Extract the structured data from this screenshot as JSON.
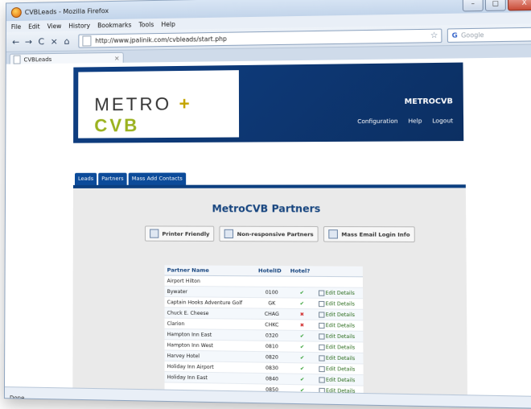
{
  "window": {
    "title": "CVBLeads - Mozilla Firefox",
    "controls": {
      "minimize": "–",
      "maximize": "□",
      "close": "X"
    }
  },
  "menu": [
    "File",
    "Edit",
    "View",
    "History",
    "Bookmarks",
    "Tools",
    "Help"
  ],
  "nav": {
    "back": "←",
    "forward": "→",
    "reload": "C",
    "stop": "×",
    "home": "⌂",
    "url": "http://www.jpalinik.com/cvbleads/start.php",
    "search_placeholder": "Google",
    "search_engine": "G"
  },
  "tabs": [
    {
      "label": "CVBLeads",
      "close": "×"
    }
  ],
  "status": "Done",
  "site": {
    "logo_left": "METRO",
    "logo_plus": "+",
    "logo_right": "CVB",
    "brand": "METROCVB",
    "header_nav": [
      "Configuration",
      "Help",
      "Logout"
    ],
    "page_tabs": [
      "Leads",
      "Partners",
      "Mass Add Contacts"
    ],
    "page_title": "MetroCVB Partners",
    "actions": [
      "Printer Friendly",
      "Non-responsive Partners",
      "Mass Email Login Info"
    ]
  },
  "table": {
    "headers": [
      "Partner Name",
      "HotelID",
      "Hotel?",
      ""
    ],
    "rows": [
      {
        "name": "Airport Hilton",
        "hotel_id": "",
        "hotel": "",
        "edit": ""
      },
      {
        "name": "Bywater",
        "hotel_id": "0100",
        "hotel": "✔",
        "edit": "Edit Details"
      },
      {
        "name": "Captain Hooks Adventure Golf",
        "hotel_id": "GK",
        "hotel": "✔",
        "edit": "Edit Details"
      },
      {
        "name": "Chuck E. Cheese",
        "hotel_id": "CHAG",
        "hotel": "✖",
        "edit": "Edit Details"
      },
      {
        "name": "Clarion",
        "hotel_id": "CHKC",
        "hotel": "✖",
        "edit": "Edit Details"
      },
      {
        "name": "Hampton Inn East",
        "hotel_id": "0320",
        "hotel": "✔",
        "edit": "Edit Details"
      },
      {
        "name": "Hampton Inn West",
        "hotel_id": "0810",
        "hotel": "✔",
        "edit": "Edit Details"
      },
      {
        "name": "Harvey Hotel",
        "hotel_id": "0820",
        "hotel": "✔",
        "edit": "Edit Details"
      },
      {
        "name": "Holiday Inn Airport",
        "hotel_id": "0830",
        "hotel": "✔",
        "edit": "Edit Details"
      },
      {
        "name": "Holiday Inn East",
        "hotel_id": "0840",
        "hotel": "✔",
        "edit": "Edit Details"
      },
      {
        "name": "",
        "hotel_id": "0850",
        "hotel": "✔",
        "edit": "Edit Details"
      }
    ]
  }
}
